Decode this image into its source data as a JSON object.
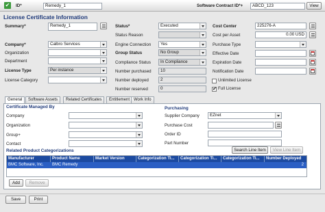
{
  "topbar": {
    "id_label": "ID*",
    "id_value": "Remedy_1",
    "contract_label": "Software Contract ID*+",
    "contract_value": "ABCD_123",
    "view_label": "View"
  },
  "header": {
    "title": "License Certificate Information"
  },
  "form": {
    "summary_label": "Summary*",
    "summary_value": "Remedy_1",
    "company_label": "Company*",
    "company_value": "Calbro Services",
    "organization_label": "Organization",
    "organization_value": "",
    "department_label": "Department",
    "department_value": "",
    "license_type_label": "License Type",
    "license_type_value": "Per instance",
    "license_category_label": "License Category",
    "license_category_value": "",
    "status_label": "Status*",
    "status_value": "Executed",
    "status_reason_label": "Status Reason",
    "status_reason_value": "",
    "engine_connection_label": "Engine Connection",
    "engine_connection_value": "Yes",
    "group_status_label": "Group Status",
    "group_status_value": "No Group",
    "compliance_status_label": "Compliance Status",
    "compliance_status_value": "In Compliance",
    "number_purchased_label": "Number purchased",
    "number_purchased_value": "10",
    "number_deployed_label": "Number deployed",
    "number_deployed_value": "2",
    "number_reserved_label": "Number reserved",
    "number_reserved_value": "0",
    "cost_center_label": "Cost Center",
    "cost_center_value": "225276-A",
    "cost_per_asset_label": "Cost per Asset",
    "cost_per_asset_value": "0.00 USD",
    "purchase_type_label": "Purchase Type",
    "purchase_type_value": "",
    "effective_date_label": "Effective Date",
    "effective_date_value": "",
    "expiration_date_label": "Expiration Date",
    "expiration_date_value": "",
    "notification_date_label": "Notification Date",
    "notification_date_value": "",
    "unlimited_license_label": "Unlimited License",
    "unlimited_license_checked": false,
    "full_license_label": "Full License",
    "full_license_checked": true
  },
  "tabs": [
    {
      "label": "General",
      "active": true
    },
    {
      "label": "Software Assets",
      "active": false
    },
    {
      "label": "Related Certificates",
      "active": false
    },
    {
      "label": "Entitlement",
      "active": false
    },
    {
      "label": "Work Info",
      "active": false
    }
  ],
  "general": {
    "managed_title": "Certificate Managed By",
    "company_label": "Company",
    "company_value": "",
    "organization_label": "Organization",
    "organization_value": "",
    "group_label": "Group+",
    "group_value": "",
    "contact_label": "Contact",
    "contact_value": "",
    "purchasing_title": "Purchasing",
    "supplier_label": "Supplier Company",
    "supplier_value": "EZnet",
    "purchase_cost_label": "Purchase Cost",
    "purchase_cost_value": "",
    "order_id_label": "Order ID",
    "order_id_value": "",
    "part_number_label": "Part Number",
    "part_number_value": "",
    "related_title": "Related Product Categorizations",
    "search_line_item_label": "Search Line Item",
    "view_line_item_label": "View Line Item",
    "table": {
      "headers": [
        "Manufacturer",
        "Product Name",
        "Market Version",
        "Categorization Ti...",
        "Categorization Ti...",
        "Categorization Ti...",
        "Number Deployed"
      ],
      "rows": [
        [
          "BMC Software, Inc.",
          "BMC Remedy",
          "",
          "",
          "",
          "",
          "2"
        ]
      ]
    },
    "add_label": "Add",
    "remove_label": "Remove"
  },
  "footer": {
    "save_label": "Save",
    "print_label": "Print"
  },
  "colors": {
    "title": "#1f3a7a",
    "table_header": "#1c4aa0",
    "table_row_selected": "#2b5fc4",
    "id_badge": "#3c9a3c"
  }
}
